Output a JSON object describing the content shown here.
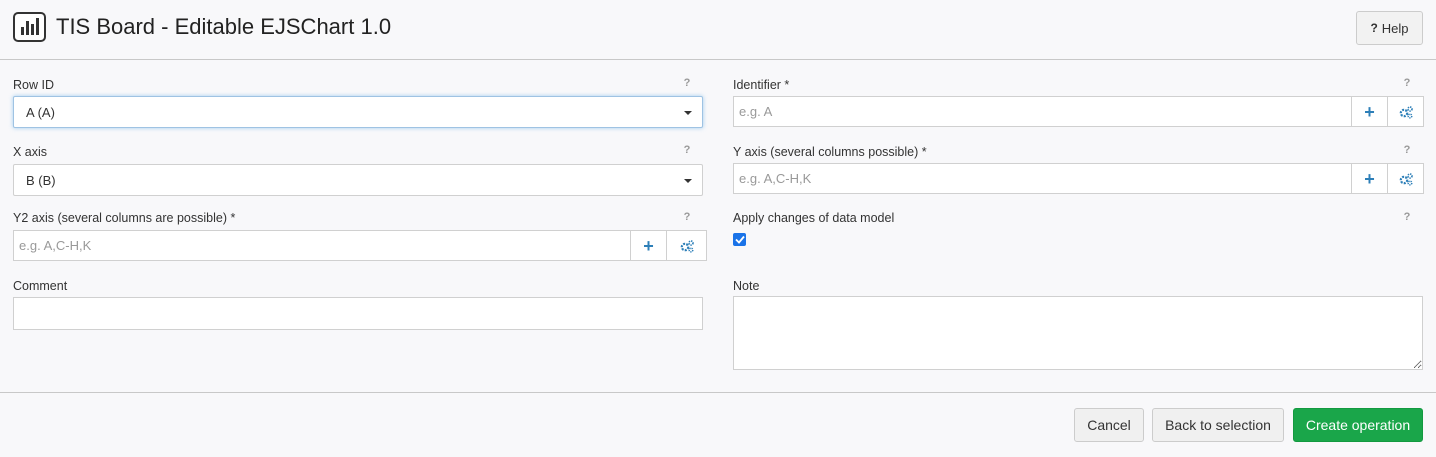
{
  "header": {
    "title": "TIS Board - Editable EJSChart 1.0",
    "help_label": "Help",
    "help_mark": "?"
  },
  "form": {
    "row_id": {
      "label": "Row ID",
      "help": "?",
      "value": "A (A)"
    },
    "x_axis": {
      "label": "X axis",
      "help": "?",
      "value": "B (B)"
    },
    "y2_axis": {
      "label": "Y2 axis (several columns are possible) *",
      "help": "?",
      "placeholder": "e.g. A,C-H,K"
    },
    "comment": {
      "label": "Comment"
    },
    "identifier": {
      "label": "Identifier *",
      "help": "?",
      "placeholder": "e.g. A"
    },
    "y_axis": {
      "label": "Y axis (several columns possible) *",
      "help": "?",
      "placeholder": "e.g. A,C-H,K"
    },
    "apply_changes": {
      "label": "Apply changes of data model",
      "help": "?",
      "checked": true
    },
    "note": {
      "label": "Note"
    }
  },
  "footer": {
    "cancel_label": "Cancel",
    "back_label": "Back to selection",
    "create_label": "Create operation"
  },
  "colors": {
    "primary": "#1aa64a",
    "addon_icon": "#2d7fb8",
    "checkbox": "#1a73e8"
  },
  "icons": {
    "logo": "bar-chart-icon",
    "add": "plus-icon",
    "config": "cogs-icon",
    "dropdown": "caret-down-icon"
  }
}
